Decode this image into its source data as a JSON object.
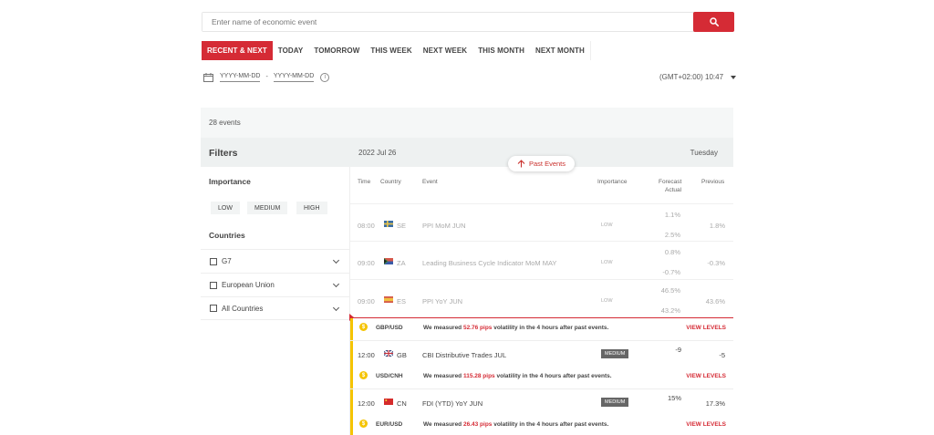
{
  "search": {
    "placeholder": "Enter name of economic event"
  },
  "tabs": [
    "RECENT & NEXT",
    "TODAY",
    "TOMORROW",
    "THIS WEEK",
    "NEXT WEEK",
    "THIS MONTH",
    "NEXT MONTH"
  ],
  "date_range": {
    "from": "YYYY-MM-DD",
    "separator": "-",
    "to": "YYYY-MM-DD"
  },
  "timezone": "(GMT+02:00) 10:47",
  "event_count": "28 events",
  "filters": {
    "title": "Filters",
    "importance_label": "Importance",
    "importance": [
      "LOW",
      "MEDIUM",
      "HIGH"
    ],
    "countries_label": "Countries",
    "countries": [
      "G7",
      "European Union",
      "All Countries"
    ]
  },
  "day_header": {
    "date": "2022 Jul 26",
    "weekday": "Tuesday"
  },
  "past_events_label": "Past Events",
  "columns": {
    "time": "Time",
    "country": "Country",
    "event": "Event",
    "importance": "Importance",
    "forecast": "Forecast",
    "actual": "Actual",
    "previous": "Previous"
  },
  "past_events": [
    {
      "time": "08:00",
      "country": "SE",
      "event": "PPI MoM JUN",
      "importance": "LOW",
      "forecast": "1.1%",
      "actual": "2.5%",
      "previous": "1.8%"
    },
    {
      "time": "09:00",
      "country": "ZA",
      "event": "Leading Business Cycle Indicator MoM MAY",
      "importance": "LOW",
      "forecast": "0.8%",
      "actual": "-0.7%",
      "previous": "-0.3%"
    },
    {
      "time": "09:00",
      "country": "ES",
      "event": "PPI YoY JUN",
      "importance": "LOW",
      "forecast": "46.5%",
      "actual": "43.2%",
      "previous": "43.6%"
    }
  ],
  "volatility": [
    {
      "pair": "GBP/USD",
      "pre": "We measured ",
      "pips": "52.76 pips",
      "post": " volatility in the 4 hours after past events.",
      "link": "VIEW LEVELS"
    },
    {
      "pair": "USD/CNH",
      "pre": "We measured ",
      "pips": "115.28 pips",
      "post": " volatility in the 4 hours after past events.",
      "link": "VIEW LEVELS"
    },
    {
      "pair": "EUR/USD",
      "pre": "We measured ",
      "pips": "26.43 pips",
      "post": " volatility in the 4 hours after past events.",
      "link": "VIEW LEVELS"
    }
  ],
  "upcoming_events": [
    {
      "time": "12:00",
      "country": "GB",
      "event": "CBI Distributive Trades JUL",
      "importance": "MEDIUM",
      "forecast": "-9",
      "previous": "-5"
    },
    {
      "time": "12:00",
      "country": "CN",
      "event": "FDI (YTD) YoY JUN",
      "importance": "MEDIUM",
      "forecast": "15%",
      "previous": "17.3%"
    }
  ],
  "colors": {
    "accent": "#d52b35",
    "volatility": "#f5c400"
  }
}
